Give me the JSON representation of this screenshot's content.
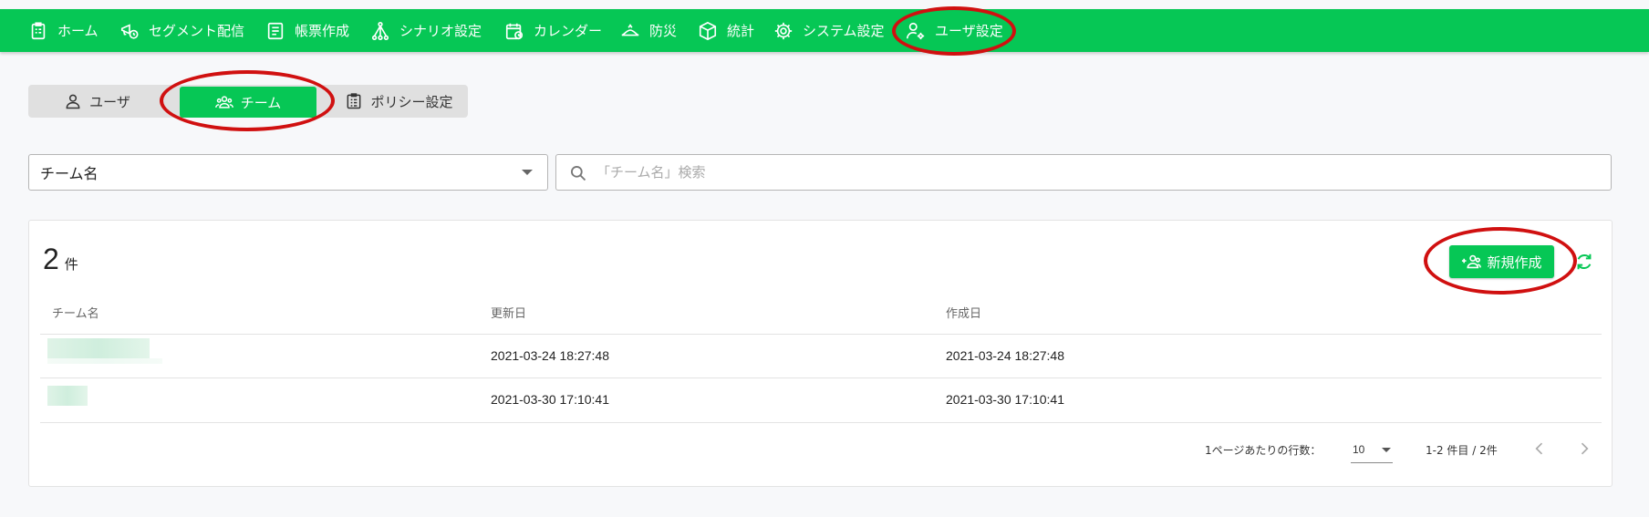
{
  "nav": {
    "items": [
      {
        "label": "ホーム",
        "icon": "clipboard-icon"
      },
      {
        "label": "セグメント配信",
        "icon": "megaphone-clock-icon"
      },
      {
        "label": "帳票作成",
        "icon": "document-icon"
      },
      {
        "label": "シナリオ設定",
        "icon": "branch-icon"
      },
      {
        "label": "カレンダー",
        "icon": "calendar-icon"
      },
      {
        "label": "防災",
        "icon": "disaster-icon"
      },
      {
        "label": "統計",
        "icon": "cube-icon"
      },
      {
        "label": "システム設定",
        "icon": "gear-icon"
      },
      {
        "label": "ユーザ設定",
        "icon": "user-gear-icon"
      }
    ],
    "background": "#06c755"
  },
  "tabs": {
    "items": [
      {
        "label": "ユーザ",
        "icon": "user-icon"
      },
      {
        "label": "チーム",
        "icon": "team-icon"
      },
      {
        "label": "ポリシー設定",
        "icon": "clipboard-list-icon"
      }
    ],
    "active": "チーム"
  },
  "filter": {
    "select_value": "チーム名",
    "search_placeholder": "「チーム名」検索"
  },
  "list": {
    "count": "2",
    "count_unit": "件",
    "new_button_label": "新規作成",
    "columns": [
      "チーム名",
      "更新日",
      "作成日"
    ],
    "rows": [
      {
        "updated": "2021-03-24 18:27:48",
        "created": "2021-03-24 18:27:48"
      },
      {
        "updated": "2021-03-30 17:10:41",
        "created": "2021-03-30 17:10:41"
      }
    ]
  },
  "pagination": {
    "rows_per_page_label": "1ページあたりの行数：",
    "rows_per_page": "10",
    "range_text": "1-2 件目 / 2件"
  },
  "colors": {
    "accent": "#06c755",
    "highlight": "#d01010"
  }
}
